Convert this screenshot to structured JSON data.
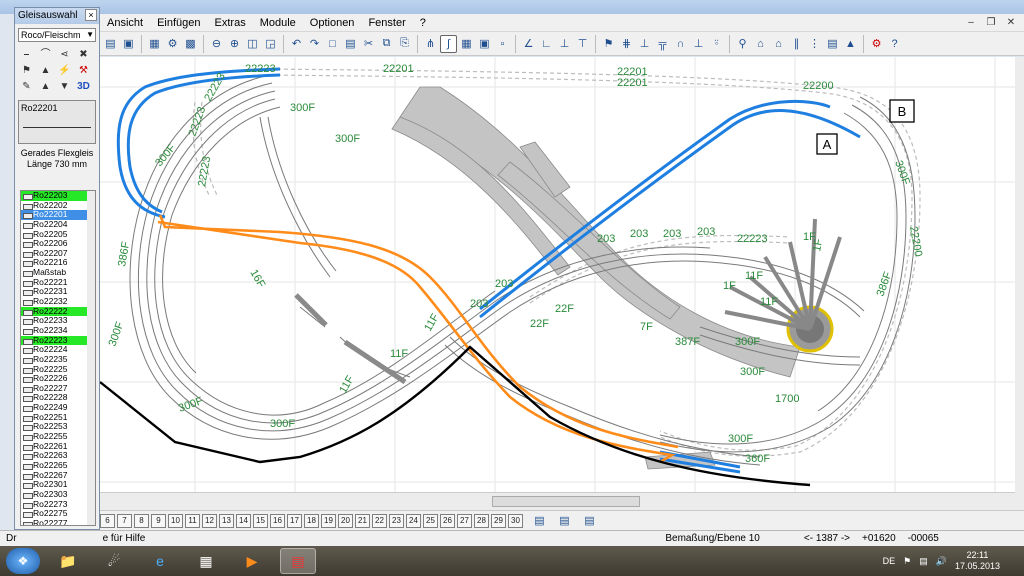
{
  "window": {
    "title": "WinTrack V10.0 - [track1]"
  },
  "menu": [
    "Ansicht",
    "Einfügen",
    "Extras",
    "Module",
    "Optionen",
    "Fenster",
    "?"
  ],
  "panel": {
    "title": "Gleisauswahl",
    "combo_value": "Roco/Fleischm",
    "selected_part": "Ro22201",
    "part_desc_line1": "Gerades Flexgleis",
    "part_desc_line2": "Länge 730 mm",
    "icon_3d": "3D",
    "parts": [
      "Ro22203",
      "Ro22202",
      "Ro22201",
      "Ro22204",
      "Ro22205",
      "Ro22206",
      "Ro22207",
      "Ro22216",
      "Maßstab",
      "Ro22221",
      "Ro22231",
      "Ro22232",
      "Ro22222",
      "Ro22233",
      "Ro22234",
      "Ro22223",
      "Ro22224",
      "Ro22235",
      "Ro22225",
      "Ro22226",
      "Ro22227",
      "Ro22228",
      "Ro22249",
      "Ro22251",
      "Ro22253",
      "Ro22255",
      "Ro22261",
      "Ro22263",
      "Ro22265",
      "Ro22267",
      "Ro22301",
      "Ro22303",
      "Ro22273",
      "Ro22275",
      "Ro22277"
    ],
    "green_rows": [
      0,
      12,
      15
    ],
    "selected_row": 2
  },
  "layers": [
    "6",
    "7",
    "8",
    "9",
    "10",
    "11",
    "12",
    "13",
    "14",
    "15",
    "16",
    "17",
    "18",
    "19",
    "20",
    "21",
    "22",
    "23",
    "24",
    "25",
    "26",
    "27",
    "28",
    "29",
    "30"
  ],
  "status": {
    "left_label": "Dr",
    "help_text": "e für Hilfe",
    "layer": "Bemaßung/Ebene 10",
    "coord1": "<- 1387 ->",
    "coord2": "+01620",
    "coord3": "-00065"
  },
  "taskbar": {
    "lang": "DE",
    "time": "22:11",
    "date": "17.05.2013"
  },
  "track_labels": {
    "a": "A",
    "b": "B",
    "l22201a": "22201",
    "l22201b": "22201",
    "l22201c": "22201",
    "l22200a": "22200",
    "l22200b": "22200",
    "l22223a": "22223",
    "l22223b": "22223",
    "l22223c": "22223",
    "l22223d": "22223",
    "l22223e": "22223",
    "l300Fa": "300F",
    "l300Fb": "300F",
    "l300Fc": "300F",
    "l300Fd": "300F",
    "l300Fe": "300F",
    "l300Ff": "300F",
    "l300Fg": "300F",
    "l300Fh": "300F",
    "l300Fi": "300F",
    "l300Fj": "300F",
    "l386Fa": "386F",
    "l386Fb": "386F",
    "l387F": "387F",
    "l360F": "360F",
    "l1Fa": "1F",
    "l1Fb": "1F",
    "l1Fc": "1F",
    "l11Fa": "11F",
    "l11Fb": "11F",
    "l11Fc": "11F",
    "l11Fd": "11F",
    "l11Fe": "11F",
    "l203a": "203",
    "l203b": "203",
    "l203c": "203",
    "l203d": "203",
    "l203e": "203",
    "l203f": "203",
    "l22Fa": "22F",
    "l22Fb": "22F",
    "l7F": "7F",
    "l16F": "16F",
    "l1700": "1700"
  }
}
